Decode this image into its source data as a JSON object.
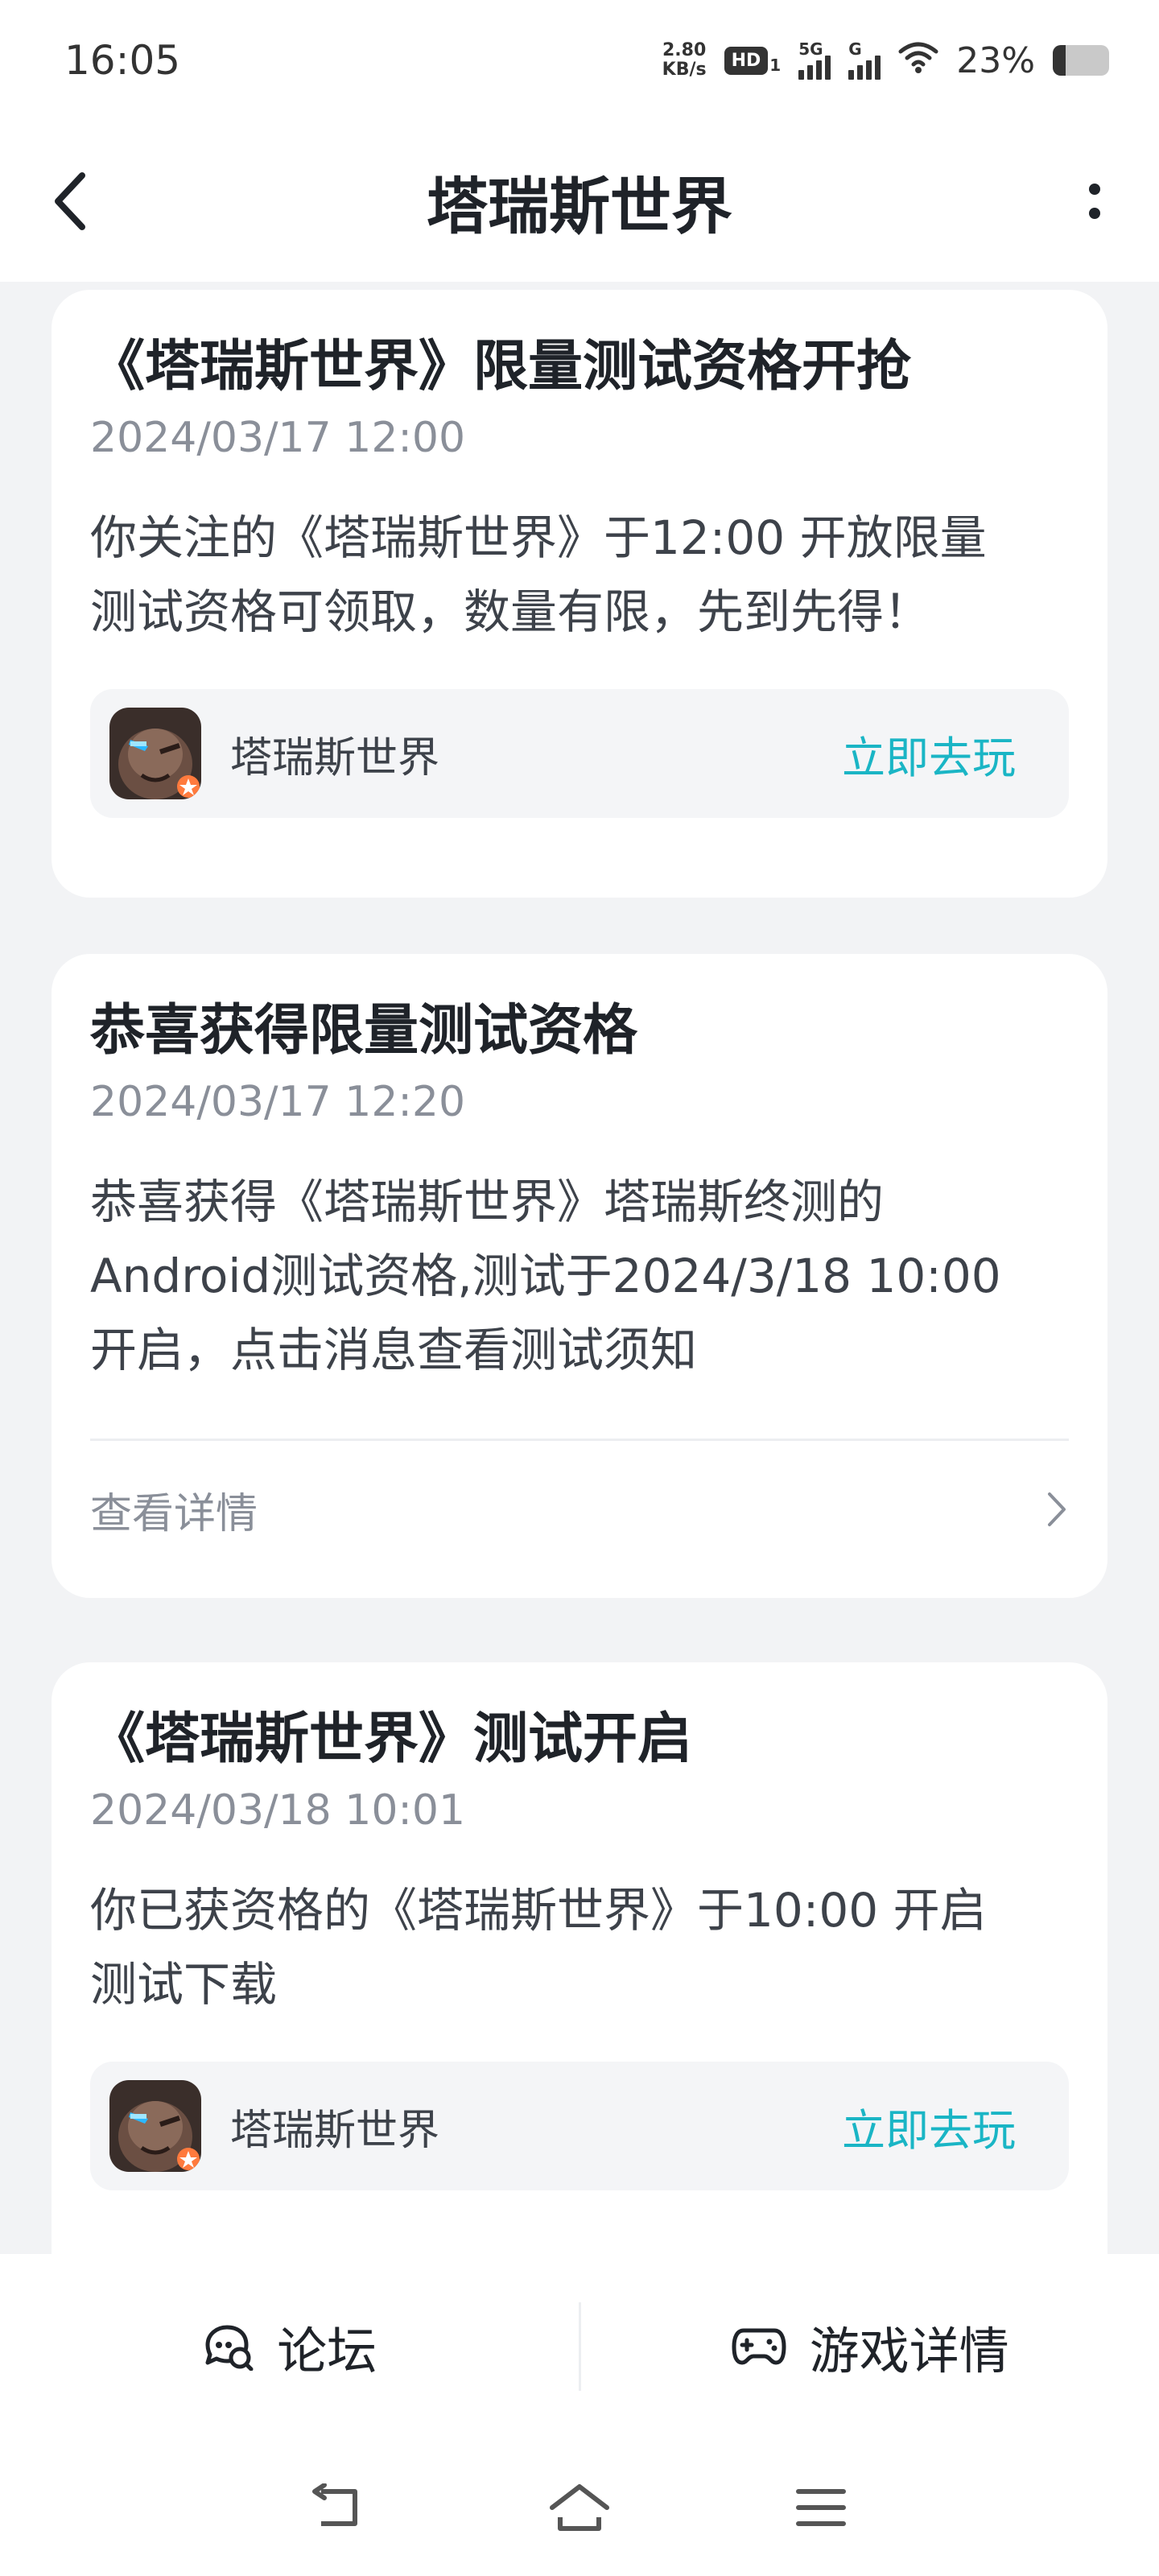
{
  "status_bar": {
    "time": "16:05",
    "net_speed_value": "2.80",
    "net_speed_unit": "KB/s",
    "hd_label": "HD",
    "hd_sub": "1",
    "signal1_label": "5G",
    "signal2_label": "G",
    "battery_text": "23%",
    "battery_level": 0.23
  },
  "header": {
    "title": "塔瑞斯世界"
  },
  "cards": [
    {
      "title": "《塔瑞斯世界》限量测试资格开抢",
      "time": "2024/03/17 12:00",
      "body_line1": "你关注的《塔瑞斯世界》于12:00 开放限量",
      "body_line2": "测试资格可领取，数量有限，先到先得！",
      "game_name": "塔瑞斯世界",
      "play_label": "立即去玩"
    },
    {
      "title": "恭喜获得限量测试资格",
      "time": "2024/03/17 12:20",
      "body_line1": "恭喜获得《塔瑞斯世界》塔瑞斯终测的",
      "body_line2": "Android测试资格,测试于2024/3/18 10:00",
      "body_line3": "开启，点击消息查看测试须知",
      "detail_label": "查看详情"
    },
    {
      "title": "《塔瑞斯世界》测试开启",
      "time": "2024/03/18 10:01",
      "body_line1": "你已获资格的《塔瑞斯世界》于10:00 开启",
      "body_line2": "测试下载",
      "game_name": "塔瑞斯世界",
      "play_label": "立即去玩"
    }
  ],
  "bottom_bar": {
    "forum_label": "论坛",
    "game_detail_label": "游戏详情"
  },
  "colors": {
    "accent": "#1ab5c5",
    "background": "#f2f3f5",
    "card": "#ffffff",
    "secondary_text": "#8a8f99"
  }
}
